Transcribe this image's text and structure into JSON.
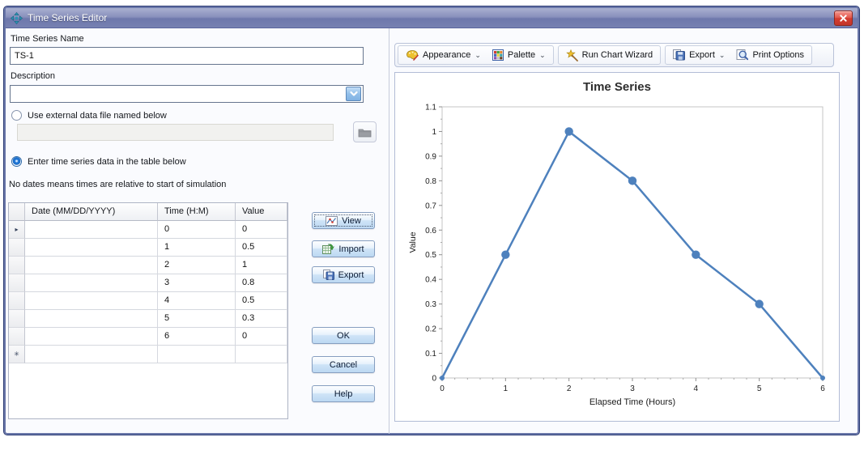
{
  "window": {
    "title": "Time Series Editor"
  },
  "form": {
    "name_label": "Time Series Name",
    "name_value": "TS-1",
    "description_label": "Description",
    "description_value": "",
    "external_radio_label": "Use external data file named below",
    "external_file_value": "",
    "table_radio_label": "Enter time series data in the table below",
    "note": "No dates means times are relative to start of simulation"
  },
  "table": {
    "columns": [
      "Date (MM/DD/YYYY)",
      "Time (H:M)",
      "Value"
    ],
    "rows": [
      {
        "date": "",
        "time": "0",
        "value": "0"
      },
      {
        "date": "",
        "time": "1",
        "value": "0.5"
      },
      {
        "date": "",
        "time": "2",
        "value": "1"
      },
      {
        "date": "",
        "time": "3",
        "value": "0.8"
      },
      {
        "date": "",
        "time": "4",
        "value": "0.5"
      },
      {
        "date": "",
        "time": "5",
        "value": "0.3"
      },
      {
        "date": "",
        "time": "6",
        "value": "0"
      }
    ],
    "current_row_marker": "▸",
    "new_row_marker": "✳"
  },
  "side_buttons": {
    "view": "View",
    "import": "Import",
    "export": "Export"
  },
  "dialog_buttons": {
    "ok": "OK",
    "cancel": "Cancel",
    "help": "Help"
  },
  "toolbar": {
    "appearance": "Appearance",
    "palette": "Palette",
    "run_chart_wizard": "Run Chart Wizard",
    "export": "Export",
    "print_options": "Print Options",
    "dropdown_glyph": "⌄"
  },
  "chart_data": {
    "type": "line",
    "title": "Time Series",
    "xlabel": "Elapsed Time (Hours)",
    "ylabel": "Value",
    "x": [
      0,
      1,
      2,
      3,
      4,
      5,
      6
    ],
    "y": [
      0,
      0.5,
      1,
      0.8,
      0.5,
      0.3,
      0
    ],
    "xlim": [
      0,
      6
    ],
    "ylim": [
      0,
      1.1
    ],
    "xticks": [
      0,
      1,
      2,
      3,
      4,
      5,
      6
    ],
    "yticks": [
      0,
      0.1,
      0.2,
      0.3,
      0.4,
      0.5,
      0.6,
      0.7,
      0.8,
      0.9,
      1,
      1.1
    ],
    "line_color": "#4e81bd",
    "grid": false,
    "legend": false
  }
}
